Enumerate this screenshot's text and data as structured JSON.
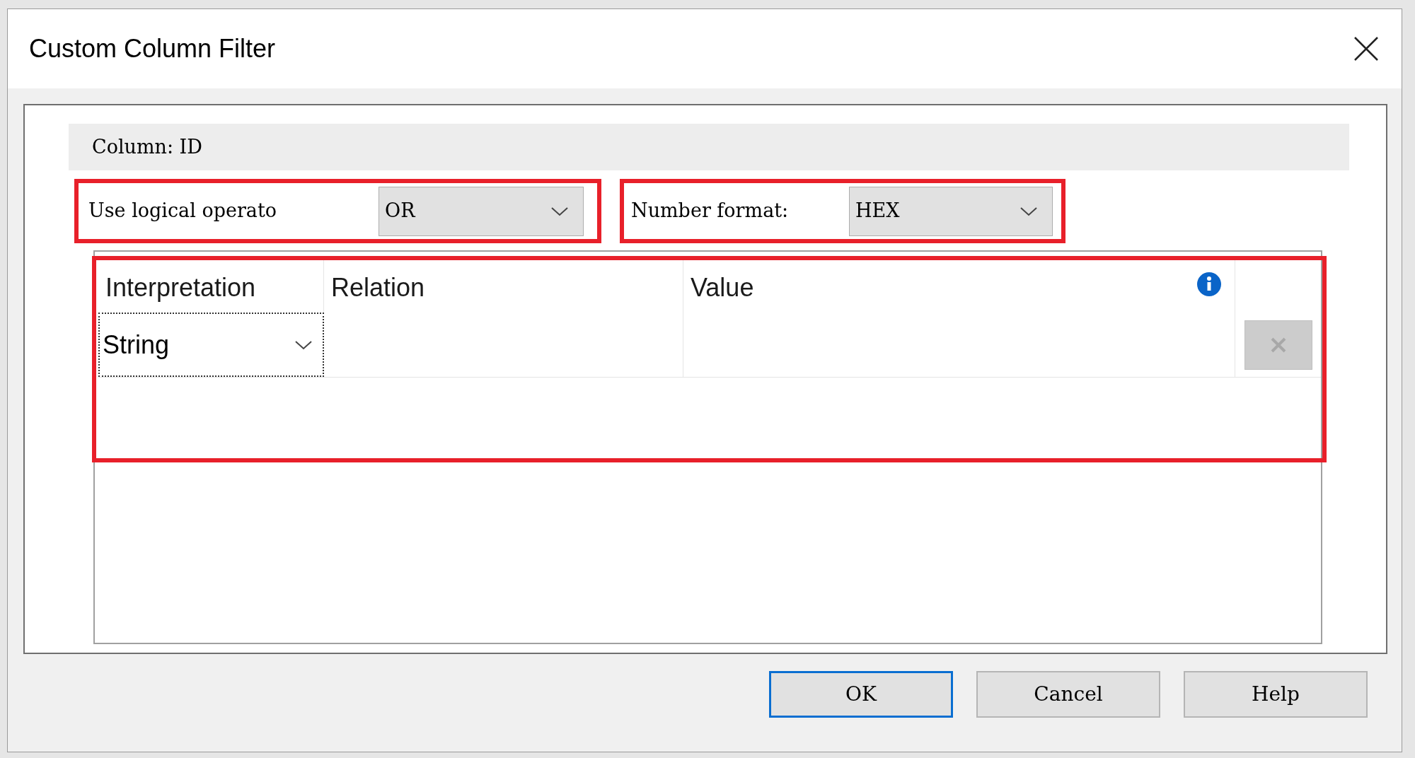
{
  "window": {
    "title": "Custom Column Filter"
  },
  "column_label": "Column: ID",
  "logical_operator": {
    "label": "Use logical operato",
    "value": "OR"
  },
  "number_format": {
    "label": "Number format:",
    "value": "HEX"
  },
  "table": {
    "columns": [
      {
        "label": "Interpretation",
        "info": false
      },
      {
        "label": "Relation",
        "info": false
      },
      {
        "label": "Value",
        "info": true
      }
    ],
    "rows": [
      {
        "interpretation": "String",
        "delete_disabled": true
      }
    ]
  },
  "buttons": [
    {
      "label": "OK",
      "default": true
    },
    {
      "label": "Cancel",
      "default": false
    },
    {
      "label": "Help",
      "default": false
    }
  ]
}
